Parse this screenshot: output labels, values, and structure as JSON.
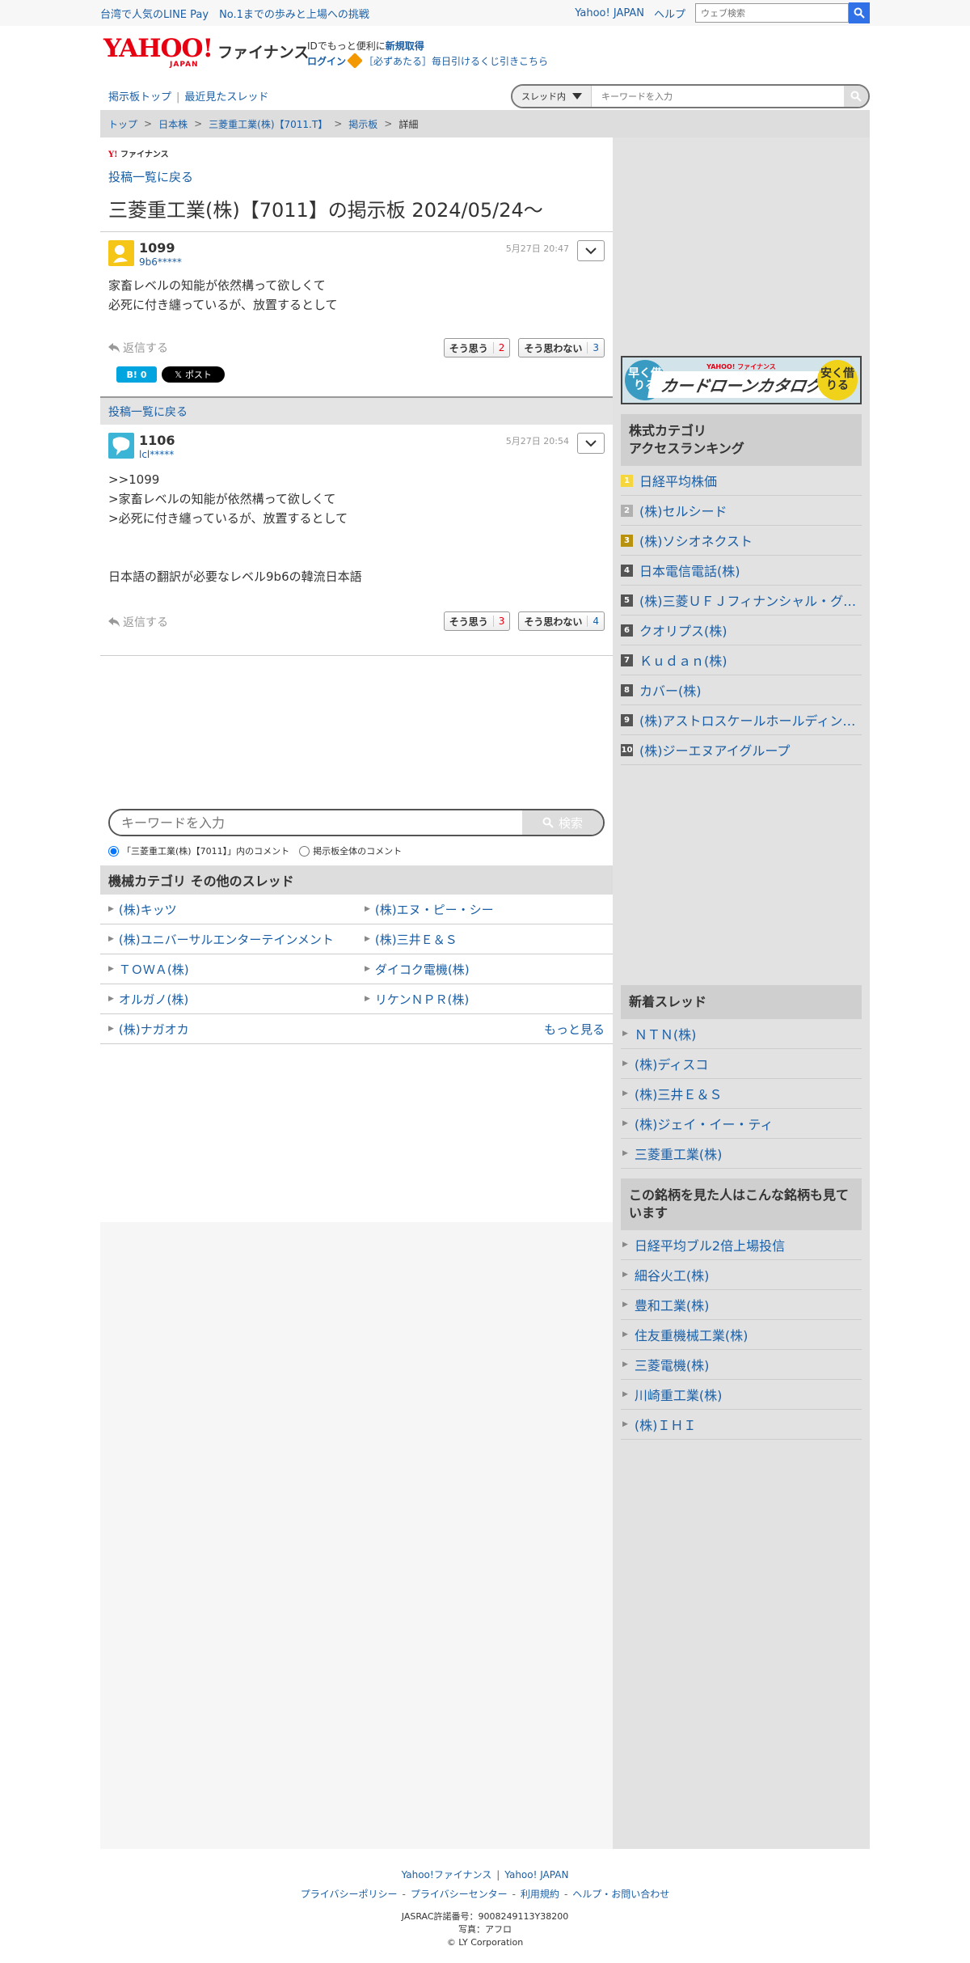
{
  "topbar": {
    "promo": "台湾で人気のLINE Pay　No.1までの歩みと上場への挑戦",
    "yahoo_japan": "Yahoo! JAPAN",
    "help": "ヘルプ",
    "web_search_placeholder": "ウェブ検索"
  },
  "header": {
    "logo_text": "YAHOO!",
    "logo_sub": "JAPAN",
    "logo_finance": "ファイナンス",
    "promo_line1_pre": "IDでもっと便利に",
    "promo_line1_link": "新規取得",
    "login": "ログイン",
    "promo_line2": "［必ずあたる］毎日引けるくじ引きこちら"
  },
  "subnav": {
    "board_top": "掲示板トップ",
    "recent_threads": "最近見たスレッド",
    "scope": "スレッド内",
    "search_placeholder": "キーワードを入力"
  },
  "breadcrumb": [
    "トップ",
    "日本株",
    "三菱重工業(株)【7011.T】",
    "掲示板",
    "詳細"
  ],
  "main": {
    "small_logo_y": "Y!",
    "small_logo_text": "ファイナンス",
    "back_to_list": "投稿一覧に戻る",
    "title": "三菱重工業(株)【7011】の掲示板 2024/05/24〜",
    "reply_label": "返信する",
    "agree_label": "そう思う",
    "disagree_label": "そう思わない",
    "hatena_label": "B!",
    "hatena_count": "0",
    "x_post_label": "ポスト",
    "posts": [
      {
        "number": "1099",
        "user": "9b6*****",
        "date": "5月27日 20:47",
        "lines": [
          "家畜レベルの知能が依然構って欲しくて",
          "必死に付き纏っているが、放置するとして"
        ],
        "agree": "2",
        "disagree": "3"
      },
      {
        "number": "1106",
        "user": "lcl*****",
        "date": "5月27日 20:54",
        "lines": [
          ">>1099",
          ">家畜レベルの知能が依然構って欲しくて",
          ">必死に付き纏っているが、放置するとして",
          "",
          "",
          "日本語の翻訳が必要なレベル9b6の韓流日本語"
        ],
        "agree": "3",
        "disagree": "4"
      }
    ],
    "search_placeholder": "キーワードを入力",
    "search_button": "検索",
    "radio_in_thread": "「三菱重工業(株)【7011】」内のコメント",
    "radio_all": "掲示板全体のコメント",
    "category_title": "機械カテゴリ  その他のスレッド",
    "category_items": [
      "(株)キッツ",
      "(株)エヌ・ピー・シー",
      "(株)ユニバーサルエンターテインメント",
      "(株)三井Ｅ＆Ｓ",
      "ＴＯＷＡ(株)",
      "ダイコク電機(株)",
      "オルガノ(株)",
      "リケンＮＰＲ(株)",
      "(株)ナガオカ"
    ],
    "more": "もっと見る"
  },
  "sidebar": {
    "banner_left": "早く借りる",
    "banner_right": "安く借りる",
    "banner_brand": "YAHOO! ファイナンス",
    "banner_text": "カードローンカタログ",
    "ranking_title": "株式カテゴリ\nアクセスランキング",
    "ranking": [
      {
        "rank": "1",
        "name": "日経平均株価"
      },
      {
        "rank": "2",
        "name": "(株)セルシード"
      },
      {
        "rank": "3",
        "name": "(株)ソシオネクスト"
      },
      {
        "rank": "4",
        "name": "日本電信電話(株)"
      },
      {
        "rank": "5",
        "name": "(株)三菱ＵＦＪフィナンシャル・グ…"
      },
      {
        "rank": "6",
        "name": "クオリプス(株)"
      },
      {
        "rank": "7",
        "name": "Ｋｕｄａｎ(株)"
      },
      {
        "rank": "8",
        "name": "カバー(株)"
      },
      {
        "rank": "9",
        "name": "(株)アストロスケールホールディン…"
      },
      {
        "rank": "10",
        "name": "(株)ジーエヌアイグループ"
      }
    ],
    "new_threads_title": "新着スレッド",
    "new_threads": [
      "ＮＴＮ(株)",
      "(株)ディスコ",
      "(株)三井Ｅ＆Ｓ",
      "(株)ジェイ・イー・ティ",
      "三菱重工業(株)"
    ],
    "also_viewed_title": "この銘柄を見た人はこんな銘柄も見ています",
    "also_viewed": [
      "日経平均ブル2倍上場投信",
      "細谷火工(株)",
      "豊和工業(株)",
      "住友重機械工業(株)",
      "三菱電機(株)",
      "川崎重工業(株)",
      "(株)ＩＨＩ"
    ]
  },
  "footer": {
    "link1": "Yahoo!ファイナンス",
    "link2": "Yahoo! JAPAN",
    "links": [
      "プライバシーポリシー",
      "プライバシーセンター",
      "利用規約",
      "ヘルプ・お問い合わせ"
    ],
    "jasrac": "JASRAC許諾番号：9008249113Y38200",
    "photo": "写真：アフロ",
    "copyright": "© LY Corporation"
  },
  "colors": {
    "link": "#1a5fa6",
    "brand_red": "#e60012",
    "agree": "#e60012",
    "disagree": "#1a5fa6",
    "rank1": "#f5d63c",
    "rank2": "#b0b0b0",
    "rank3": "#b8920f",
    "rank_other": "#555555"
  }
}
